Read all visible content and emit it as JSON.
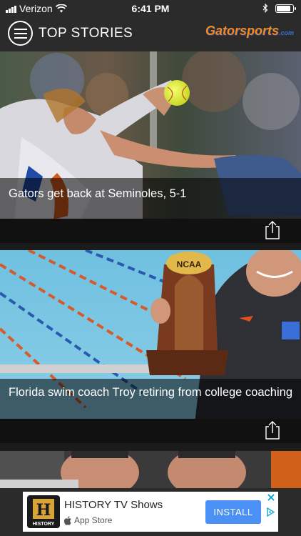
{
  "status_bar": {
    "carrier": "Verizon",
    "time": "6:41 PM",
    "battery_level": 0.85
  },
  "nav": {
    "title": "TOP STORIES",
    "brand_name": "Gatorsports",
    "brand_suffix": ".com"
  },
  "stories": [
    {
      "headline": "Gators get back at Seminoles, 5-1"
    },
    {
      "headline": "Florida swim coach Troy retiring from college coaching"
    },
    {
      "headline": ""
    }
  ],
  "ad": {
    "app_name": "HISTORY TV Shows",
    "store_name": "App Store",
    "install_label": "INSTALL",
    "app_icon_letter": "H",
    "app_icon_caption": "HISTORY",
    "colors": {
      "install": "#4a90f5",
      "brand_orange": "#f58a1f"
    }
  }
}
